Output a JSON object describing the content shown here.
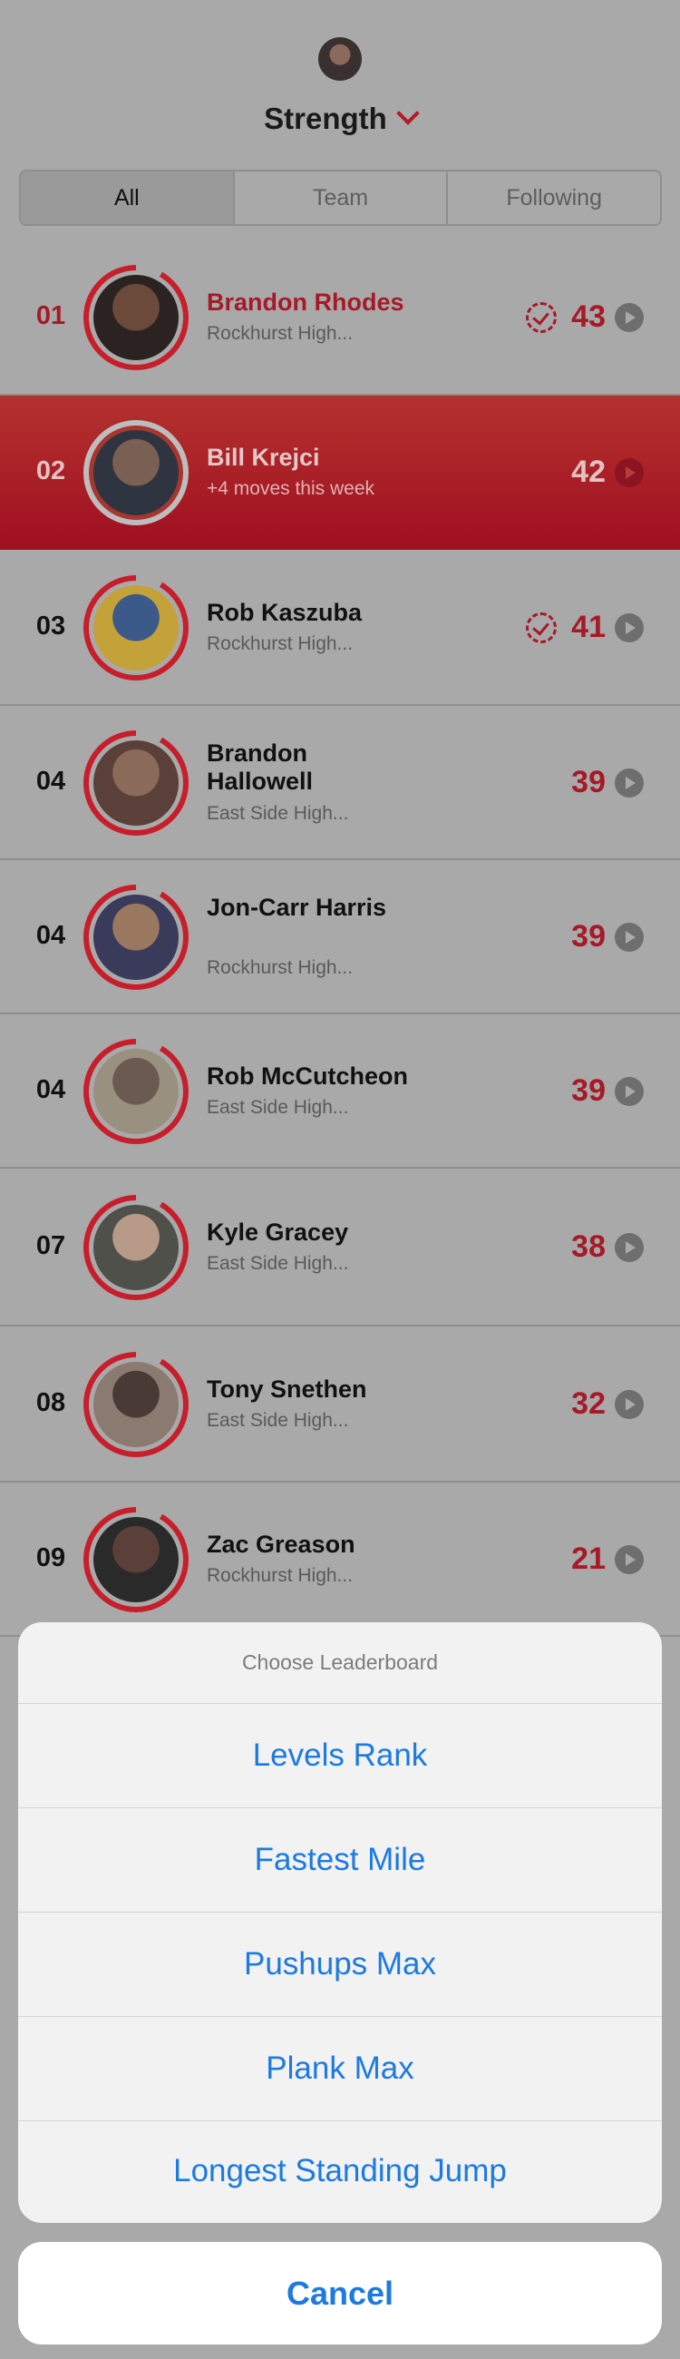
{
  "header": {
    "title": "Strength",
    "avatar_icon": "user-avatar",
    "chevron_icon": "chevron-down-icon",
    "accent_color": "#b21a28"
  },
  "segments": [
    {
      "label": "All",
      "active": true
    },
    {
      "label": "Team",
      "active": false
    },
    {
      "label": "Following",
      "active": false
    }
  ],
  "leaderboard": [
    {
      "rank": "01",
      "name": "Brandon Rhodes",
      "sub": "Rockhurst High...",
      "score": "43",
      "verified": true,
      "style": "top"
    },
    {
      "rank": "02",
      "name": "Bill Krejci",
      "sub": "+4 moves this week",
      "score": "42",
      "verified": false,
      "style": "highlight"
    },
    {
      "rank": "03",
      "name": "Rob Kaszuba",
      "sub": "Rockhurst High...",
      "score": "41",
      "verified": true,
      "style": "normal"
    },
    {
      "rank": "04",
      "name": "Brandon Hallowell",
      "sub": "East Side High...",
      "score": "39",
      "verified": false,
      "style": "normal"
    },
    {
      "rank": "04",
      "name": "Jon-Carr Harris",
      "sub": "Rockhurst High...",
      "score": "39",
      "verified": false,
      "style": "normal"
    },
    {
      "rank": "04",
      "name": "Rob McCutcheon",
      "sub": "East Side High...",
      "score": "39",
      "verified": false,
      "style": "normal"
    },
    {
      "rank": "07",
      "name": "Kyle Gracey",
      "sub": "East Side High...",
      "score": "38",
      "verified": false,
      "style": "normal"
    },
    {
      "rank": "08",
      "name": "Tony Snethen",
      "sub": "East Side High...",
      "score": "32",
      "verified": false,
      "style": "normal"
    },
    {
      "rank": "09",
      "name": "Zac Greason",
      "sub": "Rockhurst High...",
      "score": "21",
      "verified": false,
      "style": "normal"
    }
  ],
  "action_sheet": {
    "title": "Choose Leaderboard",
    "options": [
      "Levels Rank",
      "Fastest Mile",
      "Pushups Max",
      "Plank Max",
      "Longest Standing Jump"
    ],
    "cancel": "Cancel",
    "link_color": "#1c7ae0"
  }
}
